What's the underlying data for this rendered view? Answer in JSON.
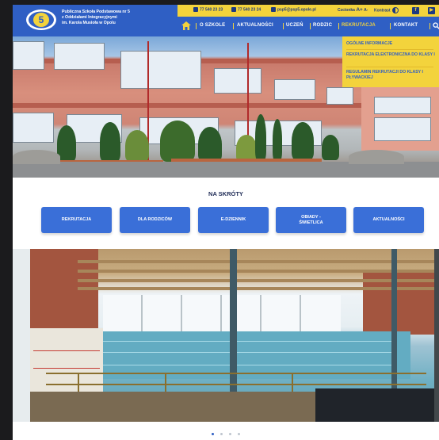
{
  "school": {
    "name_lines": [
      "Publiczna Szkoła Podstawowa nr 5",
      "z Oddziałami Integracyjnymi",
      "im. Karola Musioła w Opolu"
    ],
    "logo_number": "5"
  },
  "topbar": {
    "phone1": "77 540 23 23",
    "phone2": "77 540 23 24",
    "email": "psp5@psp5.opole.pl",
    "font_label": "Czcionka",
    "font_bigger": "A+",
    "font_smaller": "A-",
    "contrast_label": "Kontrast",
    "facebook": "f",
    "youtube": "▶"
  },
  "nav": {
    "items": [
      "O SZKOLE",
      "AKTUALNOŚCI",
      "UCZEŃ",
      "RODZIC",
      "REKRUTACJA",
      "KONTAKT"
    ],
    "active": "REKRUTACJA"
  },
  "dropdown": {
    "items": [
      "OGÓLNE INFORMACJE",
      "REKRUTACJA ELEKTRONICZNA DO KLASY I",
      "REGULAMIN REKRUTACJI DO KLASY I PŁYWACKIEJ"
    ]
  },
  "shortcuts": {
    "title": "NA SKRÓTY",
    "buttons": [
      "REKRUTACJA",
      "DLA RODZICÓW",
      "E-DZIENNIK",
      "OBIADY - ŚWIETLICA",
      "AKTUALNOŚCI"
    ]
  },
  "slider": {
    "slides": 4,
    "active_index": 0
  },
  "colors": {
    "brand_blue": "#2f5fc4",
    "accent_yellow": "#f3d33c",
    "button_blue": "#3a6fd8",
    "heading_dark": "#1d2a55"
  }
}
